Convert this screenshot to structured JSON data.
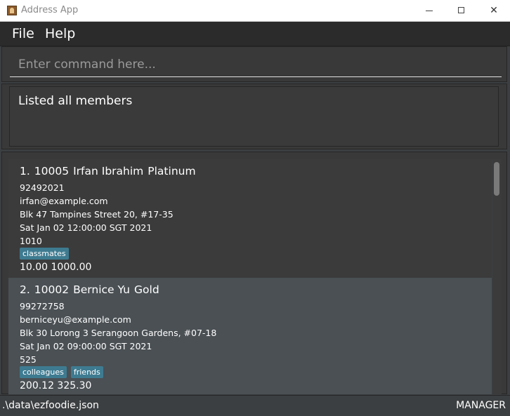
{
  "window": {
    "title": "Address App",
    "minimize_glyph": "",
    "maximize_glyph": "",
    "close_glyph": "✕"
  },
  "menu": {
    "items": [
      {
        "label": "File"
      },
      {
        "label": "Help"
      }
    ]
  },
  "command": {
    "placeholder": "Enter command here...",
    "value": ""
  },
  "result": {
    "text": "Listed all members"
  },
  "members": [
    {
      "index": "1.",
      "id": "10005",
      "name": "Irfan Ibrahim",
      "tier": "Platinum",
      "phone": "92492021",
      "email": "irfan@example.com",
      "address": "Blk 47 Tampines Street 20, #17-35",
      "date": "Sat Jan 02 12:00:00 SGT 2021",
      "points": "1010",
      "tags": [
        "classmates"
      ],
      "amounts": "10.00 1000.00"
    },
    {
      "index": "2.",
      "id": "10002",
      "name": "Bernice Yu",
      "tier": "Gold",
      "phone": "99272758",
      "email": "berniceyu@example.com",
      "address": "Blk 30 Lorong 3 Serangoon Gardens, #07-18",
      "date": "Sat Jan 02 09:00:00 SGT 2021",
      "points": "525",
      "tags": [
        "colleagues",
        "friends"
      ],
      "amounts": "200.12 325.30"
    }
  ],
  "status": {
    "file_path": ".\\data\\ezfoodie.json",
    "mode": "MANAGER"
  },
  "colors": {
    "background": "#3c3f41",
    "menubar": "#2b2b2b",
    "selected_card": "#4a5054",
    "tag": "#3e7b91"
  }
}
